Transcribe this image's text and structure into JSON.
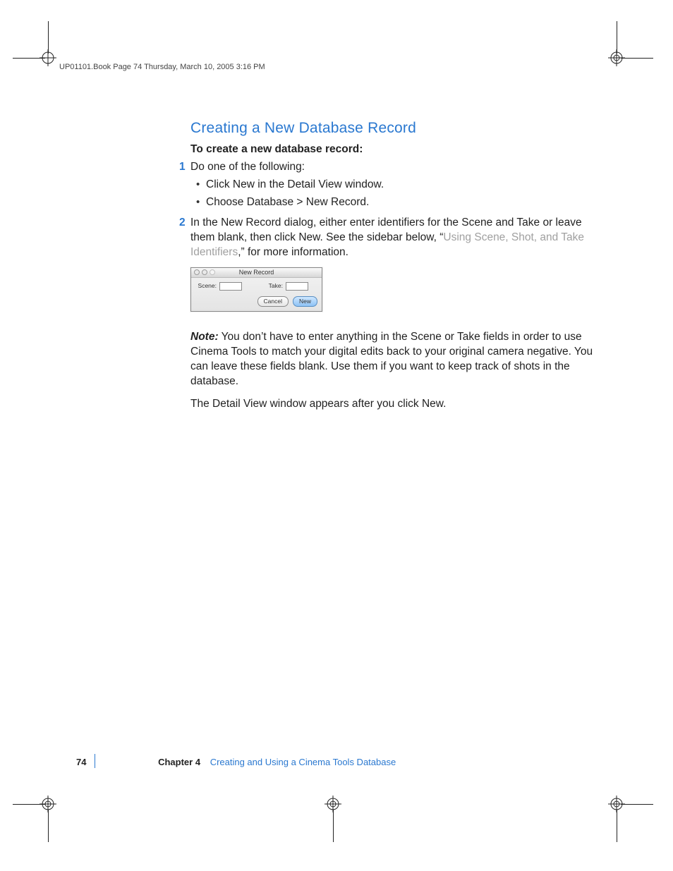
{
  "header": "UP01101.Book  Page 74  Thursday, March 10, 2005  3:16 PM",
  "section_title": "Creating a New Database Record",
  "lead": "To create a new database record:",
  "step1_num": "1",
  "step1_text": "Do one of the following:",
  "bullet1": "Click New in the Detail View window.",
  "bullet2": "Choose Database > New Record.",
  "step2_num": "2",
  "step2_pre": "In the New Record dialog, either enter identifiers for the Scene and Take or leave them blank, then click New. See the sidebar below, “",
  "step2_link": "Using Scene, Shot, and Take Identifiers",
  "step2_post": ",” for more information.",
  "dialog": {
    "title": "New Record",
    "scene_label": "Scene:",
    "take_label": "Take:",
    "cancel": "Cancel",
    "new": "New"
  },
  "note_label": "Note:",
  "note_text": "  You don’t have to enter anything in the Scene or Take fields in order to use Cinema Tools to match your digital edits back to your original camera negative. You can leave these fields blank. Use them if you want to keep track of shots in the database.",
  "after_note": "The Detail View window appears after you click New.",
  "footer": {
    "page": "74",
    "chapter_label": "Chapter 4",
    "chapter_title": "Creating and Using a Cinema Tools Database"
  }
}
